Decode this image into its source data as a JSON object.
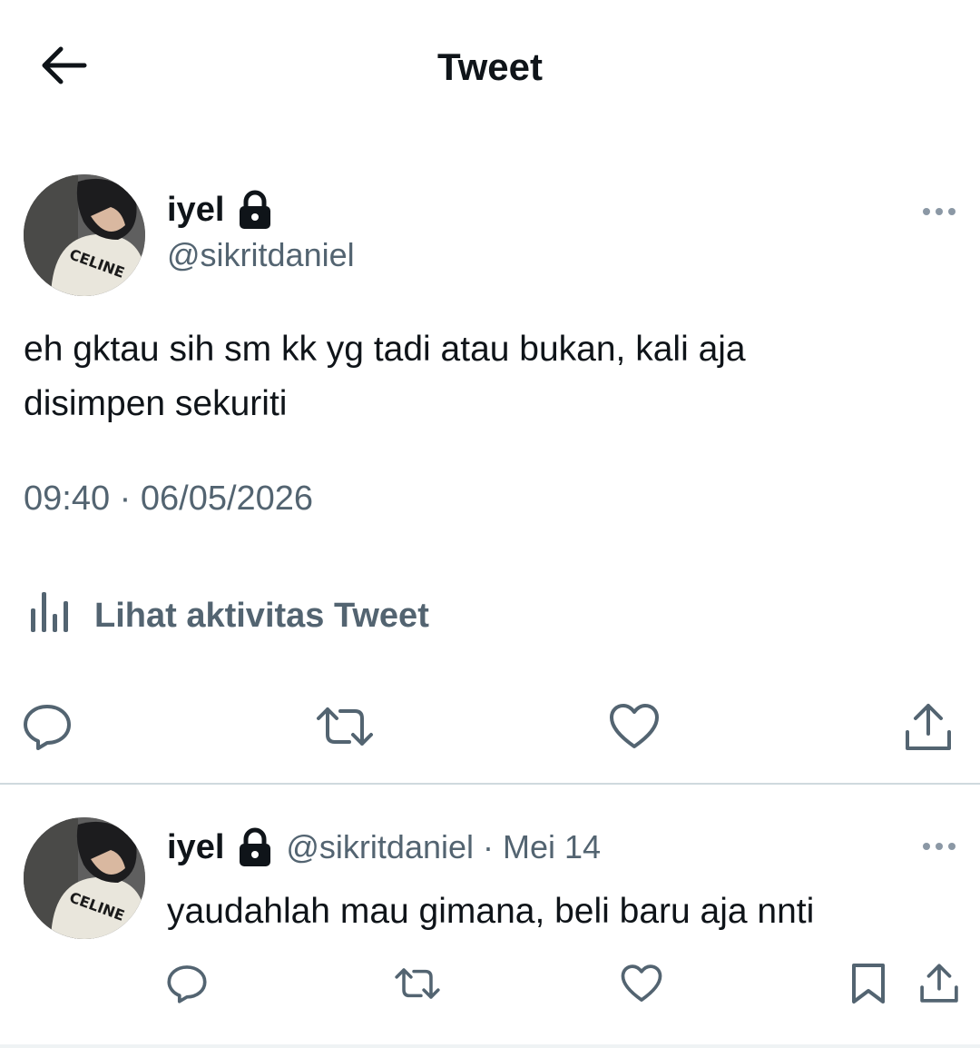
{
  "header": {
    "title": "Tweet",
    "back_icon": "arrow-left-icon"
  },
  "main_tweet": {
    "author": {
      "display_name": "iyel",
      "handle": "@sikritdaniel",
      "protected_icon": "lock-icon"
    },
    "text_line1": "eh gktau sih sm kk yg tadi atau bukan, kali aja",
    "text_line2": "disimpen sekuriti",
    "timestamp": "09:40 · 06/05/2026",
    "activity_label": "Lihat aktivitas Tweet",
    "actions": [
      "reply-icon",
      "retweet-icon",
      "like-icon",
      "share-icon"
    ]
  },
  "reply_tweet": {
    "author": {
      "display_name": "iyel",
      "handle": "@sikritdaniel",
      "separator": "·",
      "date": "Mei 14"
    },
    "text": "yaudahlah mau gimana, beli baru aja nnti",
    "actions": [
      "reply-icon",
      "retweet-icon",
      "like-icon",
      "bookmark-icon",
      "share-icon"
    ]
  },
  "colors": {
    "text_primary": "#0f1419",
    "text_secondary": "#536471",
    "divider": "#cfd9de",
    "background": "#ffffff"
  }
}
